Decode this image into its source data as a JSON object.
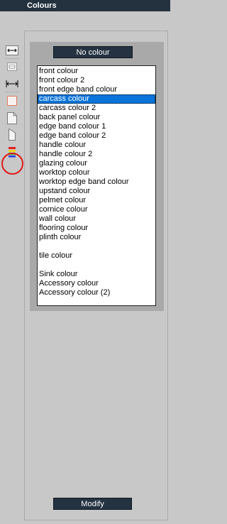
{
  "window": {
    "title": "Colours"
  },
  "toolbar": {
    "tools": [
      {
        "name": "width-arrows-icon"
      },
      {
        "name": "cabinet-front-icon"
      },
      {
        "name": "horizontal-arrows-icon"
      },
      {
        "name": "red-square-icon"
      },
      {
        "name": "page-icon"
      },
      {
        "name": "side-panel-icon"
      },
      {
        "name": "colours-icon"
      }
    ]
  },
  "colours": {
    "no_colour_label": "No colour",
    "modify_label": "Modify",
    "selected_index": 3,
    "items": [
      "front colour",
      "front colour 2",
      "front edge band colour",
      "carcass colour",
      "carcass colour 2",
      "back panel colour",
      "edge band colour 1",
      "edge band colour 2",
      "handle colour",
      "handle colour 2",
      "glazing colour",
      "worktop colour",
      "worktop edge band colour",
      "upstand colour",
      "pelmet colour",
      "cornice colour",
      "wall colour",
      "flooring colour",
      "plinth colour",
      "",
      "tile colour",
      "",
      "Sink colour",
      "Accessory colour",
      "Accessory colour (2)"
    ]
  },
  "colors": {
    "title_bg": "#24313f",
    "button_bg": "#243241",
    "selection": "#0a74d9",
    "highlight_ring": "#e01a1a"
  }
}
